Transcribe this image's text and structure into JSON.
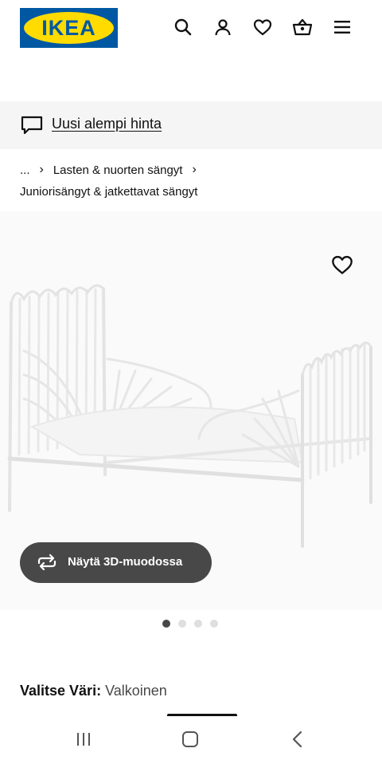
{
  "header": {
    "logo_text": "IKEA",
    "icons": [
      "search-icon",
      "account-icon",
      "heart-icon",
      "basket-icon",
      "menu-icon"
    ]
  },
  "banner": {
    "icon": "chat-bubble-icon",
    "link_text": "Uusi alempi hinta"
  },
  "breadcrumb": {
    "ellipsis": "...",
    "separator": "›",
    "item1": "Lasten & nuorten sängyt",
    "item2": "Juniorisängyt & jatkettavat sängyt"
  },
  "product": {
    "favourite_icon": "heart-icon",
    "view_3d_label": "Näytä 3D-muodossa",
    "view_3d_icon": "rotate-icon",
    "carousel": {
      "count": 4,
      "active": 1
    }
  },
  "color_selector": {
    "label": "Valitse Väri:",
    "value": "Valkoinen"
  },
  "system_nav": {
    "icons": [
      "recent-apps-icon",
      "home-icon",
      "back-icon"
    ]
  },
  "colors": {
    "ikea_blue": "#0058a3",
    "ikea_yellow": "#ffdb00",
    "button_dark": "#484848",
    "banner_bg": "#f5f5f5"
  }
}
